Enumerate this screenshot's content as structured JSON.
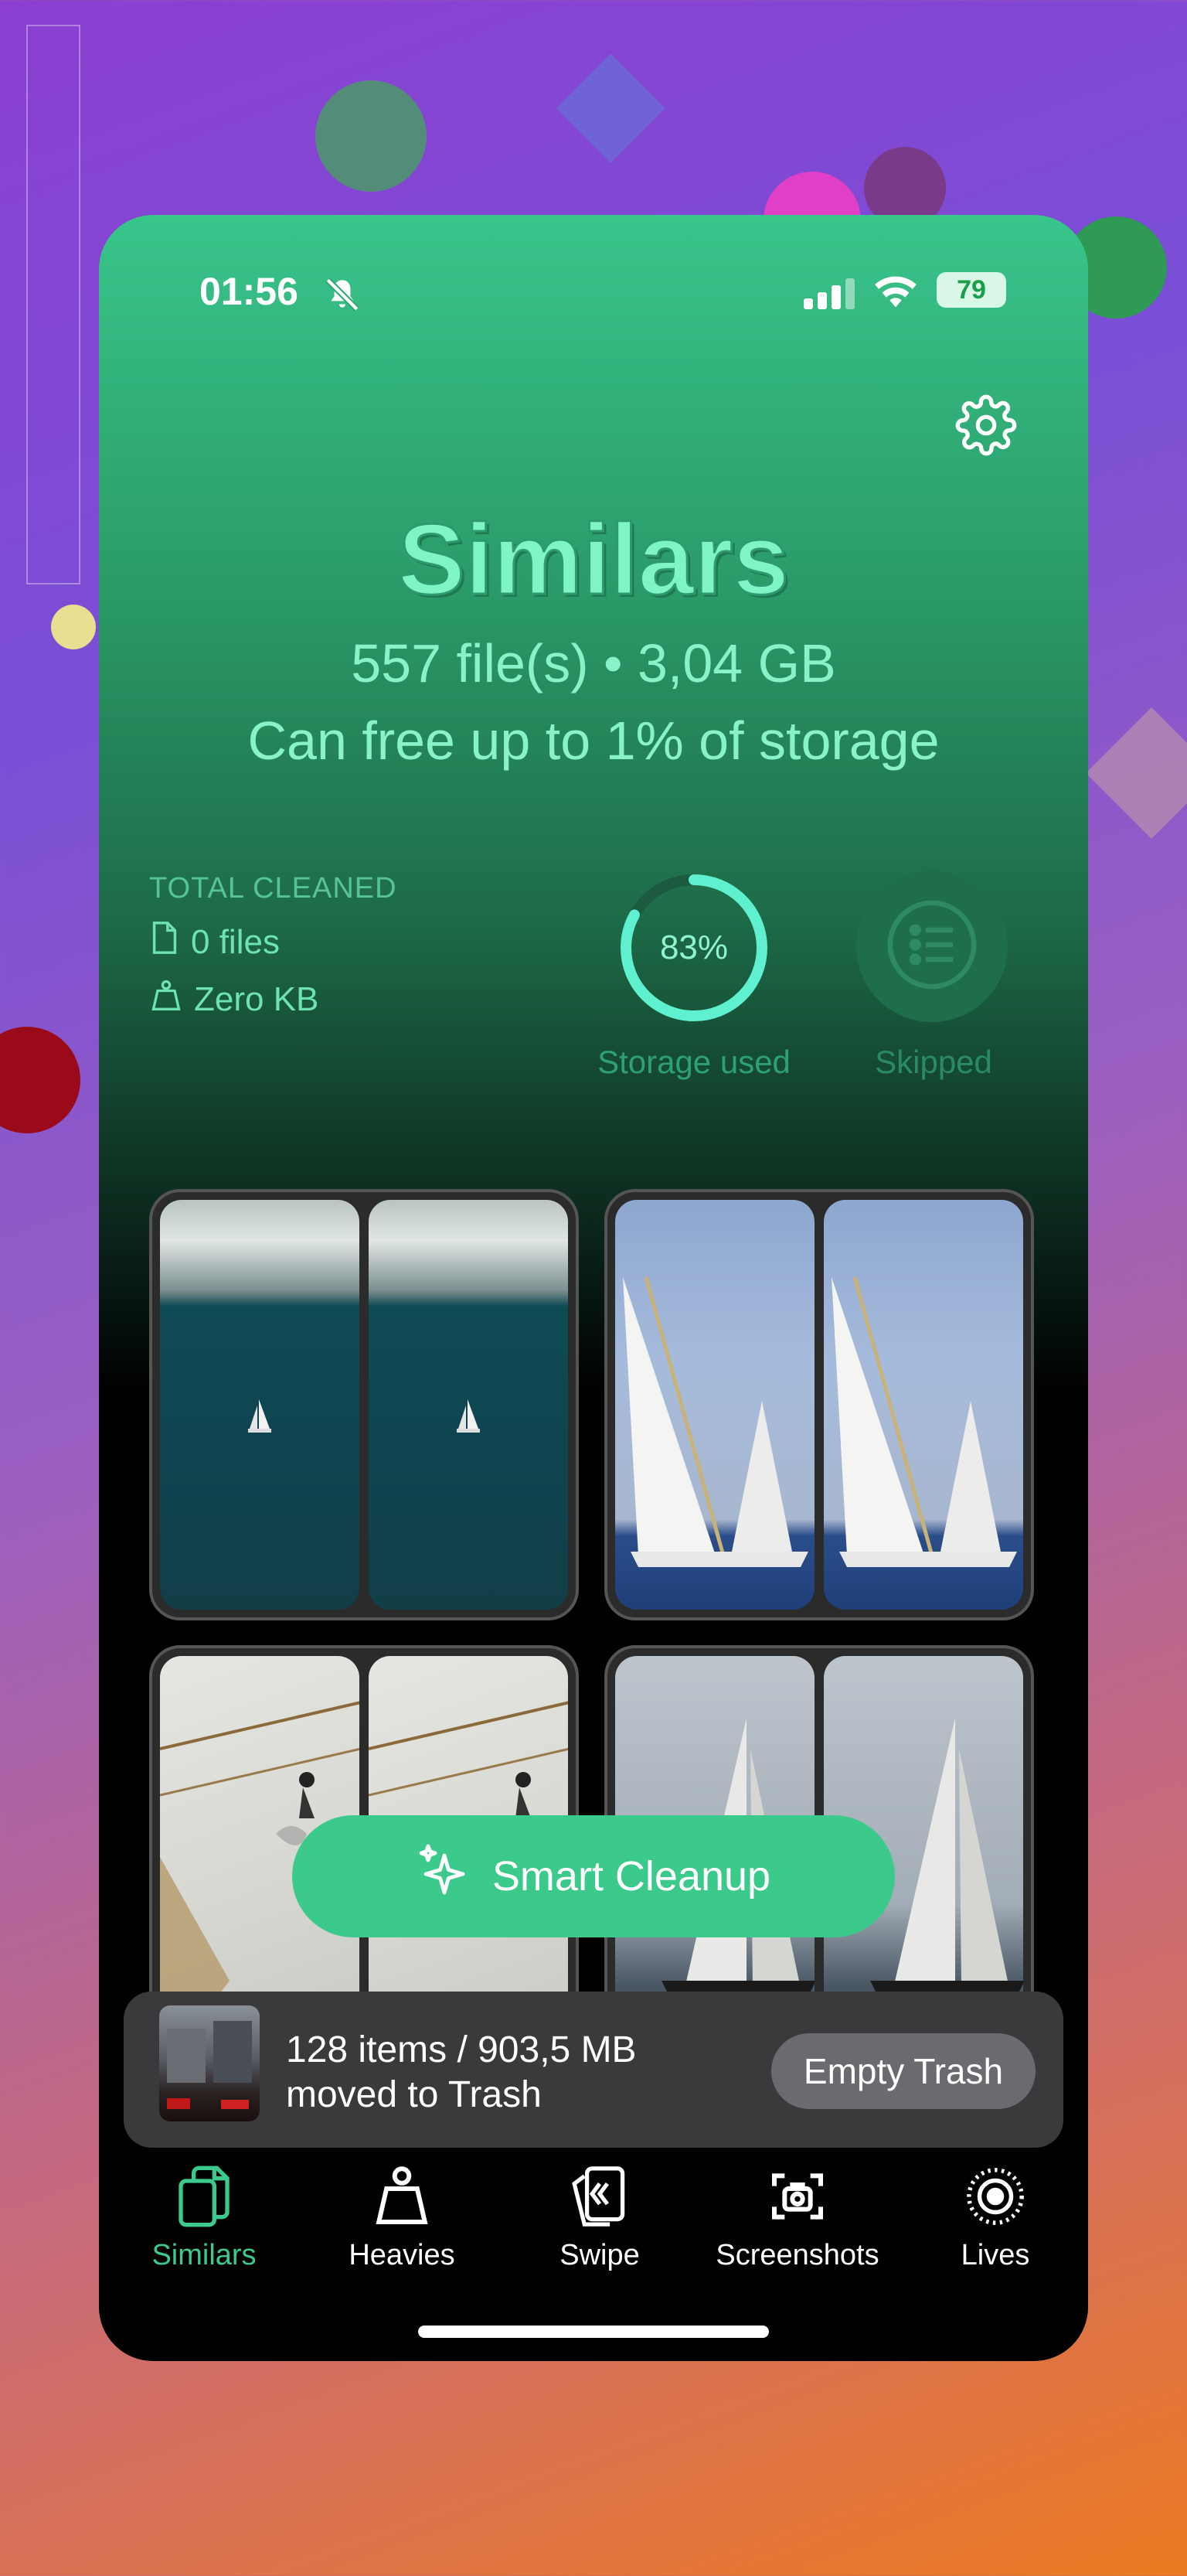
{
  "status": {
    "time": "01:56",
    "battery": "79"
  },
  "header": {
    "title": "Similars",
    "summary": "557 file(s) • 3,04 GB",
    "free_hint": "Can free up to 1% of storage"
  },
  "stats": {
    "label": "TOTAL CLEANED",
    "files": "0 files",
    "size": "Zero KB",
    "storage_percent_text": "83%",
    "storage_fraction": 0.83,
    "storage_label": "Storage used",
    "skipped_label": "Skipped"
  },
  "smart_cleanup": {
    "label": "Smart Cleanup"
  },
  "trash": {
    "line1": "128 items / 903,5 MB",
    "line2": "moved to Trash",
    "button": "Empty Trash"
  },
  "tabs": [
    {
      "label": "Similars",
      "active": true,
      "icon": "copy-icon"
    },
    {
      "label": "Heavies",
      "active": false,
      "icon": "weight-icon"
    },
    {
      "label": "Swipe",
      "active": false,
      "icon": "swipe-cards-icon"
    },
    {
      "label": "Screenshots",
      "active": false,
      "icon": "screenshot-icon"
    },
    {
      "label": "Lives",
      "active": false,
      "icon": "live-photo-icon"
    }
  ],
  "colors": {
    "accent": "#3cc98c",
    "title": "#7ff5c6",
    "ring": "#5ff0cf"
  }
}
